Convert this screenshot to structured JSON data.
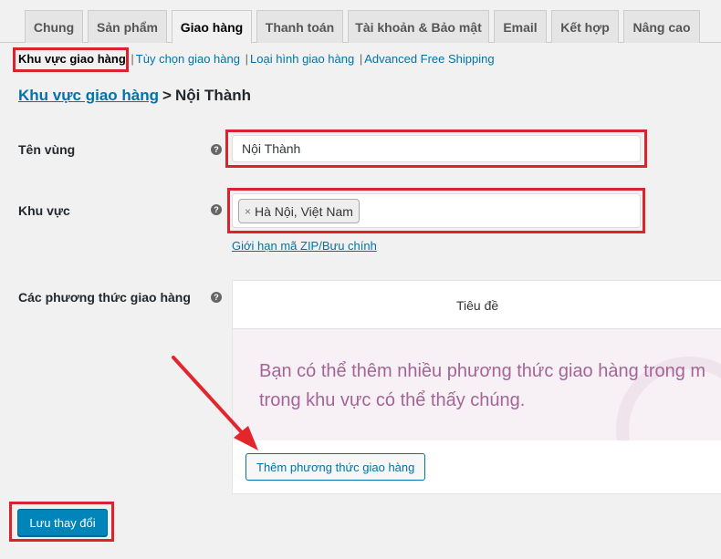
{
  "tabs": [
    {
      "label": "Chung"
    },
    {
      "label": "Sản phẩm"
    },
    {
      "label": "Giao hàng"
    },
    {
      "label": "Thanh toán"
    },
    {
      "label": "Tài khoản & Bảo mật"
    },
    {
      "label": "Email"
    },
    {
      "label": "Kết hợp"
    },
    {
      "label": "Nâng cao"
    }
  ],
  "active_tab": "Giao hàng",
  "subnav": {
    "current": "Khu vực giao hàng",
    "links": [
      "Tùy chọn giao hàng",
      "Loại hình giao hàng",
      "Advanced Free Shipping"
    ],
    "separator": "|"
  },
  "breadcrumb": {
    "link": "Khu vực giao hàng",
    "arrow": ">",
    "current": "Nội Thành"
  },
  "fields": {
    "zone_name": {
      "label": "Tên vùng",
      "value": "Nội Thành"
    },
    "zone_regions": {
      "label": "Khu vực",
      "chip": "Hà Nội, Việt Nam",
      "chip_remove": "×",
      "zip_link": "Giới hạn mã ZIP/Bưu chính"
    },
    "shipping_methods": {
      "label": "Các phương thức giao hàng",
      "column_header": "Tiêu đề",
      "blank_line1": "Bạn có thể thêm nhiều phương thức giao hàng trong m",
      "blank_line2": "trong khu vực có thể thấy chúng.",
      "add_button": "Thêm phương thức giao hàng"
    }
  },
  "help_glyph": "?",
  "save_button": "Lưu thay đổi",
  "colors": {
    "accent": "#0073aa",
    "primary_button": "#0085ba",
    "highlight_box": "#d9232d",
    "woo_purple": "#a46497"
  }
}
